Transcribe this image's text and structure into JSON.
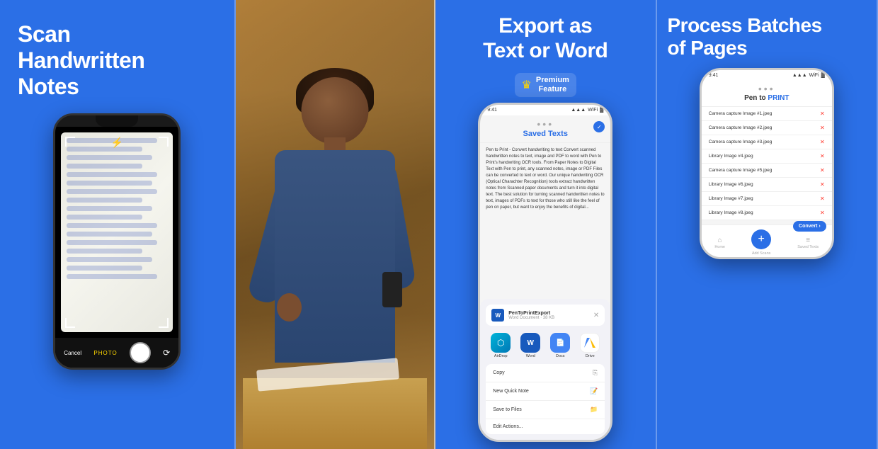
{
  "panels": [
    {
      "id": "panel1",
      "bg_color": "#2B6FE6",
      "title": "Scan\nHandwritten\nNotes",
      "phone": {
        "mode_label": "PHOTO",
        "cancel_label": "Cancel",
        "handwriting_lines": 18
      }
    },
    {
      "id": "panel2",
      "type": "photo",
      "alt": "Person writing handwritten notes"
    },
    {
      "id": "panel3",
      "bg_color": "#2B6FE6",
      "title": "Export as\nText or Word",
      "premium_badge": {
        "crown": "♛",
        "line1": "Premium",
        "line2": "Feature"
      },
      "phone": {
        "time": "9:41",
        "signal": "●●●●",
        "wifi": "WiFi",
        "battery": "▓",
        "dots": "•••",
        "header_title": "Saved Texts",
        "content_text": "Pen to Print - Convert handwriting to text\nConvert scanned handwritten notes to text,\nimage and PDF to word with Pen to Print's\nhandwriting OCR tools.\nFrom Paper Notes to Digital Text with Pen to\nprint, any scanned notes, image or PDF Files\ncan be converted to text or word. Our unique\nhandwriting OCR (Optical Charachter\nRecognition) tools extract handwritten notes\nfrom Scanned paper documents and turn it\ninto digital text. The best solution for turning\nscanned handwritten notes to text, images of\nPDFs to text for those who still like the feel of\npen on paper, but want to enjoy the benefits\nof digital...",
        "share_sheet": {
          "file_name": "PenToPrintExport",
          "file_type": "Word Document · 38 KB",
          "apps": [
            "AirDrop",
            "Word",
            "Docs",
            "Drive"
          ],
          "actions": [
            "Copy",
            "New Quick Note",
            "Save to Files",
            "Edit Actions..."
          ]
        }
      }
    },
    {
      "id": "panel4",
      "bg_color": "#2B6FE6",
      "title": "Process Batches\nof Pages",
      "phone": {
        "time": "9:41",
        "signal": "●●●",
        "wifi": "WiFi",
        "battery": "▓",
        "dots": "•••",
        "header_title": "Pen to PRINT",
        "files": [
          "Camera capture Image #1.jpeg",
          "Camera capture Image #2.jpeg",
          "Camera capture Image #3.jpeg",
          "Library Image #4.jpeg",
          "Camera capture Image #5.jpeg",
          "Library Image #6.jpeg",
          "Library Image #7.jpeg",
          "Library Image #8.jpeg"
        ],
        "tabs": [
          "Home",
          "Add Scans",
          "Saved Texts"
        ],
        "convert_label": "Convert ›"
      }
    }
  ],
  "icons": {
    "crown": "♛",
    "close": "✕",
    "check": "✓",
    "plus": "+",
    "flash": "⚡"
  }
}
